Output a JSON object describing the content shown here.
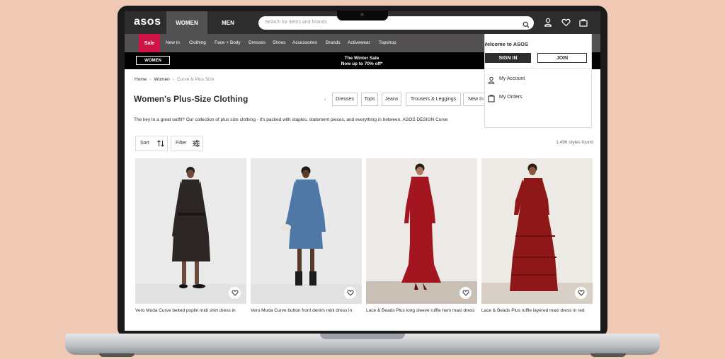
{
  "header": {
    "logo": "asos",
    "tabs": [
      {
        "label": "WOMEN",
        "active": true
      },
      {
        "label": "MEN",
        "active": false
      }
    ],
    "search_placeholder": "Search for items and brands",
    "icons": [
      "search-icon",
      "account-icon",
      "heart-icon",
      "bag-icon"
    ]
  },
  "nav": {
    "sale_label": "Sale",
    "items": [
      "New in",
      "Clothing",
      "Face + Body",
      "Dresses",
      "Shoes",
      "Accessories",
      "Brands",
      "Activewear",
      "Topshop"
    ],
    "sale_color": "#d01345"
  },
  "promo": {
    "button_label": "WOMEN",
    "line1": "The Winter Sale",
    "line2": "Now up to 70% off*"
  },
  "account_menu": {
    "welcome": "Welcome to ASOS",
    "sign_in": "SIGN IN",
    "join": "JOIN",
    "links": [
      {
        "label": "My Account",
        "icon": "user-icon"
      },
      {
        "label": "My Orders",
        "icon": "orders-icon"
      }
    ]
  },
  "breadcrumb": [
    "Home",
    "Women",
    "Curve & Plus Size"
  ],
  "page": {
    "title": "Women's Plus-Size Clothing",
    "filter_pills": [
      "Dresses",
      "Tops",
      "Jeans",
      "Trousers & Leggings",
      "New In"
    ],
    "intro": "The key to a great outfit? Our collection of plus size clothing - it's packed with staples, statement pieces, and everything in between. ASOS DESIGN Curve",
    "sort_label": "Sort",
    "filter_label": "Filter",
    "styles_found": "1,496 styles found"
  },
  "products": [
    {
      "name": "Vero Moda Curve belted poplin midi shirt dress in",
      "dress_color": "#2c2624"
    },
    {
      "name": "Vero Moda Curve button front denim mini dress in",
      "dress_color": "#4f78a6"
    },
    {
      "name": "Lace & Beads Plus long sleeve ruffle hem maxi dress",
      "dress_color": "#a3161f"
    },
    {
      "name": "Lace & Beads Plus ruffle layered maxi dress in red",
      "dress_color": "#8e1818"
    }
  ],
  "colors": {
    "header_bg": "#2d2d2d",
    "nav_bg": "#525050",
    "background": "#f0c9b5"
  }
}
